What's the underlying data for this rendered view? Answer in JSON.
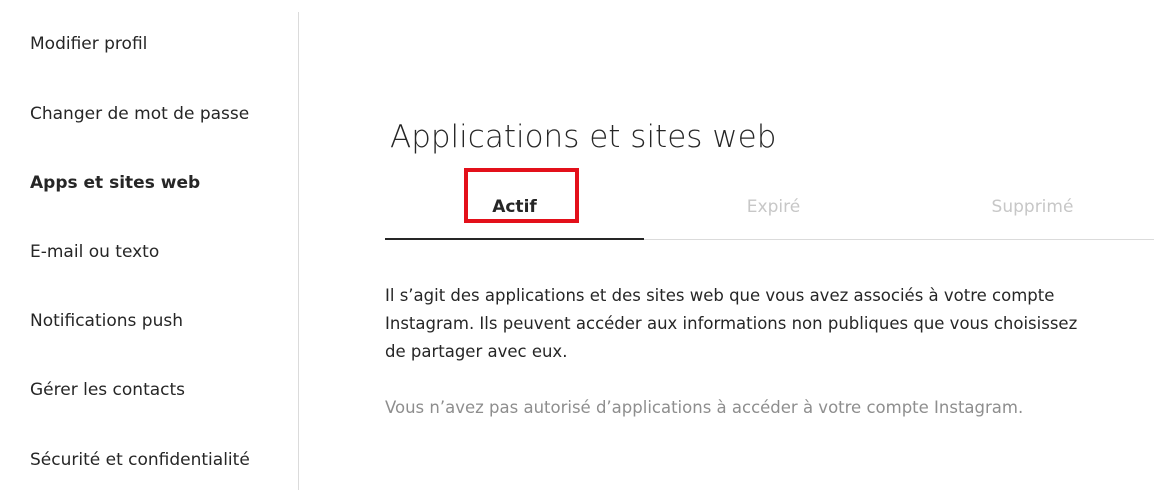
{
  "sidebar": {
    "items": [
      {
        "label": "Modifier profil",
        "active": false
      },
      {
        "label": "Changer de mot de passe",
        "active": false
      },
      {
        "label": "Apps et sites web",
        "active": true
      },
      {
        "label": "E-mail ou texto",
        "active": false
      },
      {
        "label": "Notifications push",
        "active": false
      },
      {
        "label": "Gérer les contacts",
        "active": false
      },
      {
        "label": "Sécurité et confidentialité",
        "active": false
      }
    ]
  },
  "main": {
    "title": "Applications et sites web",
    "tabs": [
      {
        "label": "Actif",
        "active": true
      },
      {
        "label": "Expiré",
        "active": false
      },
      {
        "label": "Supprimé",
        "active": false
      }
    ],
    "description_lines": [
      "Il s’agit des applications et des sites web que vous avez associés à votre compte",
      "Instagram. Ils peuvent accéder aux informations non publiques que vous choisissez",
      "de partager avec eux."
    ],
    "empty_note": "Vous n’avez pas autorisé d’applications à accéder à votre compte Instagram."
  },
  "colors": {
    "text": "#262626",
    "muted": "#8e8e8e",
    "inactive_tab": "#c7c7c7",
    "divider": "#dbdbdb",
    "highlight": "#e3101a"
  }
}
